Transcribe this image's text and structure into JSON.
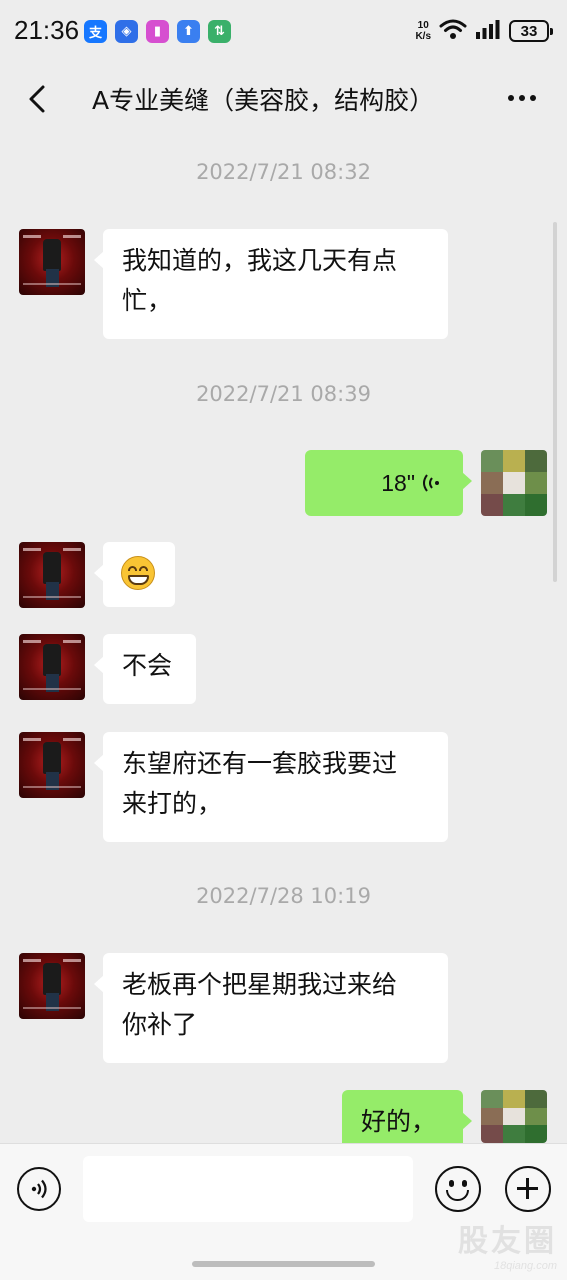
{
  "status_bar": {
    "time": "21:36",
    "net_speed_value": "10",
    "net_speed_unit": "K/s",
    "battery": "33",
    "app_icons": [
      {
        "name": "alipay-icon",
        "glyph": "支",
        "color": "#1677ff"
      },
      {
        "name": "shield-app-icon",
        "glyph": "◈",
        "color": "#2f6fe8"
      },
      {
        "name": "colorful-app-icon",
        "glyph": "▮",
        "color": "#d64fd0"
      },
      {
        "name": "upload-app-icon",
        "glyph": "⬆",
        "color": "#3a7ff0"
      },
      {
        "name": "transfer-app-icon",
        "glyph": "⇅",
        "color": "#3ab06a"
      }
    ]
  },
  "header": {
    "title": "A专业美缝（美容胶，结构胶）"
  },
  "timestamps": {
    "t1": "2022/7/21 08:32",
    "t2": "2022/7/21 08:39",
    "t3": "2022/7/28 10:19"
  },
  "messages": {
    "m1": "我知道的，我这几天有点\n忙，",
    "m2_voice_duration": "18\"",
    "m3_emoji": "grinning-face-emoji",
    "m4": "不会",
    "m5": "东望府还有一套胶我要过\n来打的，",
    "m6": "老板再个把星期我过来给\n你补了",
    "m7": "好的，"
  },
  "input": {
    "placeholder": ""
  },
  "watermark": {
    "main": "股友圈",
    "sub": "18qiang.com"
  },
  "colors": {
    "background": "#ededed",
    "sent_bubble": "#95ec69",
    "received_bubble": "#ffffff",
    "timestamp_text": "#a9a9a9"
  }
}
